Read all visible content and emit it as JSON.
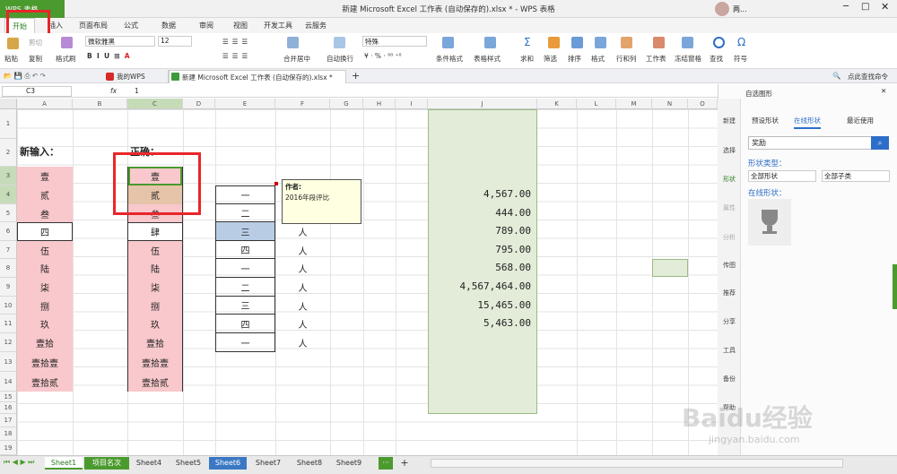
{
  "window": {
    "app_button": "WPS 表格",
    "title": "新建 Microsoft Excel 工作表 (自动保存的).xlsx * - WPS 表格",
    "user": "两..."
  },
  "ribbon_tabs": [
    "开始",
    "插入",
    "页面布局",
    "公式",
    "数据",
    "审阅",
    "视图",
    "开发工具",
    "云服务"
  ],
  "ribbon": {
    "paste": "粘贴",
    "cut": "剪切",
    "copy": "复制",
    "format_painter": "格式刷",
    "font_name": "微软雅黑",
    "font_size": "12",
    "merge_center": "合并居中",
    "wrap_text": "自动换行",
    "number_format": "特殊",
    "cond_format": "条件格式",
    "table_style": "表格样式",
    "sum": "求和",
    "filter": "筛选",
    "sort": "排序",
    "format": "格式",
    "row_col": "行和列",
    "worksheet": "工作表",
    "freeze": "冻结窗格",
    "find": "查找",
    "symbol": "符号"
  },
  "doc_tabs": [
    "我的WPS",
    "新建 Microsoft Excel 工作表 (自动保存的).xlsx *"
  ],
  "search_cmd": "点此查找命令",
  "formula_bar": {
    "cell_ref": "C3",
    "fx": "fx",
    "value": "1"
  },
  "columns": [
    "A",
    "B",
    "C",
    "D",
    "E",
    "F",
    "G",
    "H",
    "I",
    "J",
    "K",
    "L",
    "M",
    "N",
    "O"
  ],
  "rows": [
    "1",
    "2",
    "3",
    "4",
    "5",
    "6",
    "7",
    "8",
    "9",
    "10",
    "11",
    "12",
    "13",
    "14",
    "15",
    "16",
    "17",
    "18",
    "19"
  ],
  "labels": {
    "a2": "新输入：",
    "c2": "正确："
  },
  "col_a": [
    "壹",
    "贰",
    "叁",
    "四",
    "伍",
    "陆",
    "柒",
    "捌",
    "玖",
    "壹拾",
    "壹拾壹",
    "壹拾贰"
  ],
  "col_c": [
    "壹",
    "贰",
    "叁",
    "肆",
    "伍",
    "陆",
    "柒",
    "捌",
    "玖",
    "壹拾",
    "壹拾壹",
    "壹拾贰"
  ],
  "col_e": [
    "一",
    "二",
    "三",
    "四",
    "一",
    "二",
    "三",
    "四",
    "一"
  ],
  "col_f": [
    "人",
    "人",
    "人",
    "人",
    "人",
    "人",
    "人"
  ],
  "col_j": [
    "4,567.00",
    "444.00",
    "789.00",
    "795.00",
    "568.00",
    "4,567,464.00",
    "15,465.00",
    "5,463.00"
  ],
  "comment": {
    "author": "作者:",
    "text": "2016年段评比"
  },
  "sheets": [
    "Sheet1",
    "项目名次",
    "Sheet4",
    "Sheet5",
    "Sheet6",
    "Sheet7",
    "Sheet8",
    "Sheet9"
  ],
  "panel": {
    "title": "自选图形",
    "tabs": [
      "预设形状",
      "在线形状",
      "最近使用"
    ],
    "search_value": "奖励",
    "shape_type_label": "形状类型：",
    "dropdown1": "全部形状",
    "dropdown2": "全部子类",
    "online_label": "在线形状：",
    "side_buttons": [
      "新建",
      "选择",
      "形状",
      "属性",
      "分析",
      "传图",
      "推荐",
      "分享",
      "工具",
      "备份",
      "帮助"
    ]
  },
  "watermark": {
    "line1": "Baidu经验",
    "line2": "jingyan.baidu.com"
  },
  "colors": {
    "accent_green": "#4b9a2e",
    "pink_cell": "#f8c8cc",
    "highlight_red": "#e8262a",
    "selected_col": "#e2ecd8"
  }
}
